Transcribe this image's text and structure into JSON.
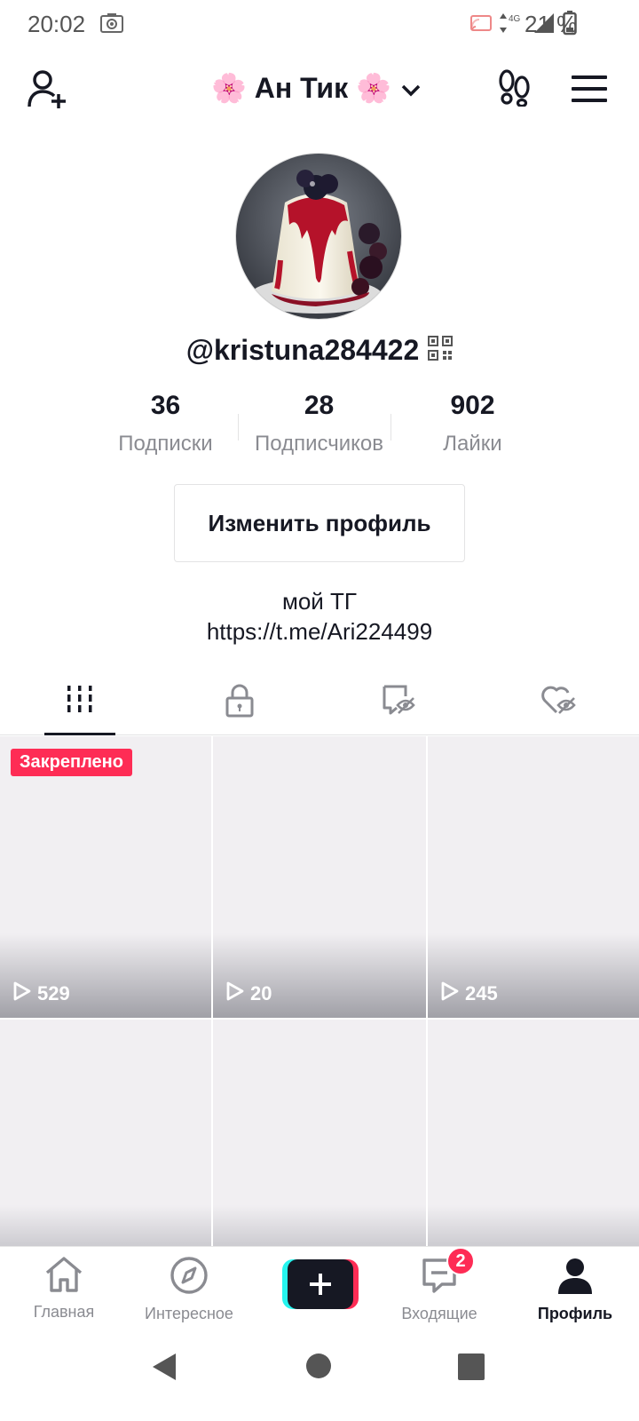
{
  "status_bar": {
    "time": "20:02",
    "network": "4G",
    "battery_percent": "21 %",
    "icons": [
      "screen-record-icon",
      "cast-icon",
      "data-arrows-icon",
      "signal-icon",
      "battery-icon"
    ]
  },
  "header": {
    "profile_name": "🌸 Ан Тик 🌸",
    "icons": [
      "add-user-icon",
      "chevron-down-icon",
      "footprints-icon",
      "hamburger-menu-icon"
    ]
  },
  "profile": {
    "username": "@kristuna284422",
    "stats": [
      {
        "value": "36",
        "label": "Подписки"
      },
      {
        "value": "28",
        "label": "Подписчиков"
      },
      {
        "value": "902",
        "label": "Лайки"
      }
    ],
    "edit_button": "Изменить профиль",
    "bio_line1": "мой ТГ",
    "bio_line2": "https://t.me/Ari224499"
  },
  "tabs": [
    {
      "name": "videos",
      "icon": "grid-icon",
      "active": true
    },
    {
      "name": "private",
      "icon": "lock-icon",
      "active": false
    },
    {
      "name": "reposts",
      "icon": "hidden-repost-icon",
      "active": false
    },
    {
      "name": "liked",
      "icon": "hidden-heart-icon",
      "active": false
    }
  ],
  "videos": [
    {
      "views": "529",
      "pinned_label": "Закреплено"
    },
    {
      "views": "20"
    },
    {
      "views": "245"
    },
    {
      "views": ""
    },
    {
      "views": ""
    },
    {
      "views": ""
    }
  ],
  "bottom_nav": {
    "home": "Главная",
    "discover": "Интересное",
    "inbox": "Входящие",
    "inbox_badge": "2",
    "profile": "Профиль"
  },
  "colors": {
    "accent_red": "#fe2c55",
    "accent_cyan": "#25f4ee",
    "text_primary": "#161823",
    "text_secondary": "#8a8b91"
  }
}
